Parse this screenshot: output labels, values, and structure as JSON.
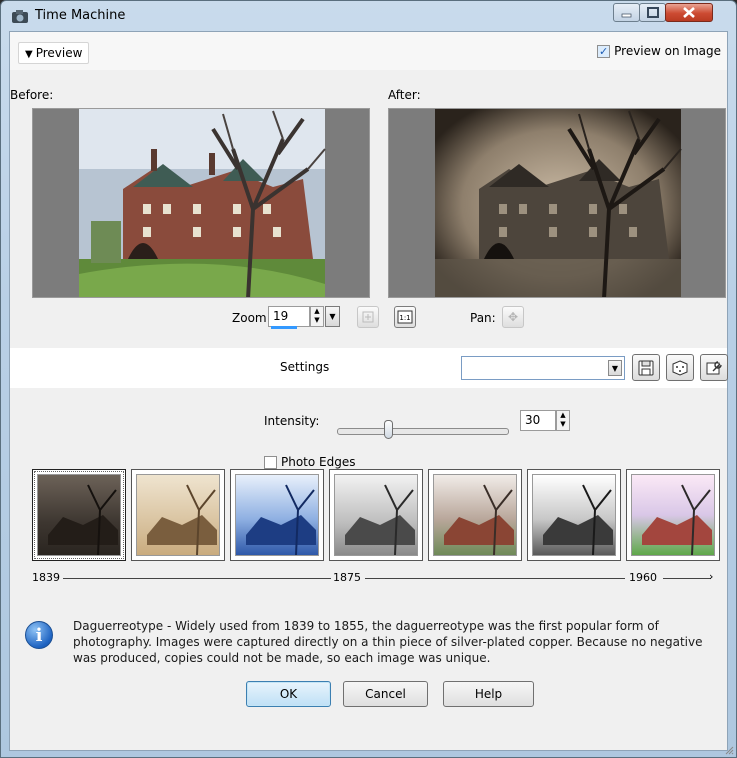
{
  "window": {
    "title": "Time Machine"
  },
  "preview": {
    "toggle_label": "Preview",
    "preview_on_image_label": "Preview on Image",
    "preview_on_image_checked": true
  },
  "panes": {
    "before_label": "Before:",
    "after_label": "After:"
  },
  "zoom": {
    "label": "Zoom:",
    "value": "19",
    "pan_label": "Pan:"
  },
  "settings": {
    "label": "Settings",
    "combo_value": ""
  },
  "intensity": {
    "label": "Intensity:",
    "value": "30",
    "level": 30
  },
  "photo_edges": {
    "label": "Photo Edges",
    "checked": false
  },
  "styles": [
    {
      "name": "daguerreotype-thumb",
      "selected": true
    },
    {
      "name": "albumen-thumb",
      "selected": false
    },
    {
      "name": "cyanotype-thumb",
      "selected": false
    },
    {
      "name": "platinum-thumb",
      "selected": false
    },
    {
      "name": "early-color-thumb",
      "selected": false
    },
    {
      "name": "black-and-white-thumb",
      "selected": false
    },
    {
      "name": "cross-process-thumb",
      "selected": false
    }
  ],
  "timeline": {
    "start": "1839",
    "mid": "1875",
    "end": "1960"
  },
  "info": {
    "text": "Daguerreotype - Widely used from 1839 to 1855, the daguerreotype was the first popular form of photography. Images were captured directly on a thin piece of silver-plated copper. Because no negative was produced, copies could not be made, so each image was unique."
  },
  "buttons": {
    "ok": "OK",
    "cancel": "Cancel",
    "help": "Help"
  },
  "colors": {
    "accent": "#3399ff",
    "info_blue": "#1f64c2"
  }
}
